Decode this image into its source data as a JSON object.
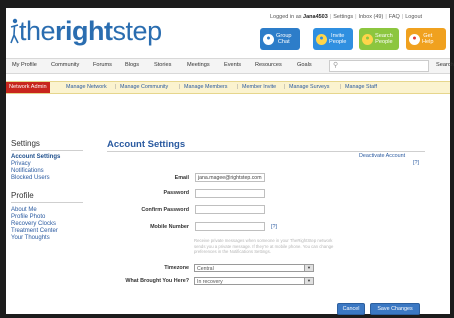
{
  "topbar": {
    "logged_in_prefix": "Logged in as ",
    "username": "Jana4503",
    "settings": "Settings",
    "inbox": "Inbox (49)",
    "faq": "FAQ",
    "logout": "Logout",
    "sep": "|"
  },
  "logo": {
    "part1": "the",
    "part2": "right",
    "part3": "step"
  },
  "header_buttons": {
    "group_chat": [
      "Group",
      "Chat"
    ],
    "invite_people": [
      "Invite",
      "People"
    ],
    "search_people": [
      "Search",
      "People"
    ],
    "get_help": [
      "Get",
      "Help"
    ]
  },
  "nav": {
    "items": [
      "My Profile",
      "Community",
      "Forums",
      "Blogs",
      "Stories",
      "Meetings",
      "Events",
      "Resources",
      "Goals"
    ],
    "search_label": "Search"
  },
  "admin": {
    "tag": "Network Admin",
    "links": [
      "Manage Network",
      "Manage Community",
      "Manage Members",
      "Member Invite",
      "Manage Surveys",
      "Manage Staff"
    ],
    "sep": "|"
  },
  "sidebar": {
    "settings_heading": "Settings",
    "settings_items": [
      "Account Settings",
      "Privacy",
      "Notifications",
      "Blocked Users"
    ],
    "profile_heading": "Profile",
    "profile_items": [
      "About Me",
      "Profile Photo",
      "Recovery Clocks",
      "Treatment Center",
      "Your Thoughts"
    ]
  },
  "main": {
    "title": "Account Settings",
    "deactivate": "Deactivate Account",
    "qmark": "[?]",
    "labels": {
      "email": "Email",
      "password": "Password",
      "confirm_password": "Confirm Password",
      "mobile": "Mobile Number",
      "timezone": "Timezone",
      "brought": "What Brought You Here?"
    },
    "email_value": "jana.magee@rightstep.com",
    "mobile_help": "Receive private messages when someone in your TheRightStep network sends you a private message. If they're at mobile phone. You can change preferences in the Notifications Settings.",
    "timezone_value": "Central",
    "brought_value": "In recovery",
    "cancel": "Cancel",
    "save": "Save Changes"
  }
}
